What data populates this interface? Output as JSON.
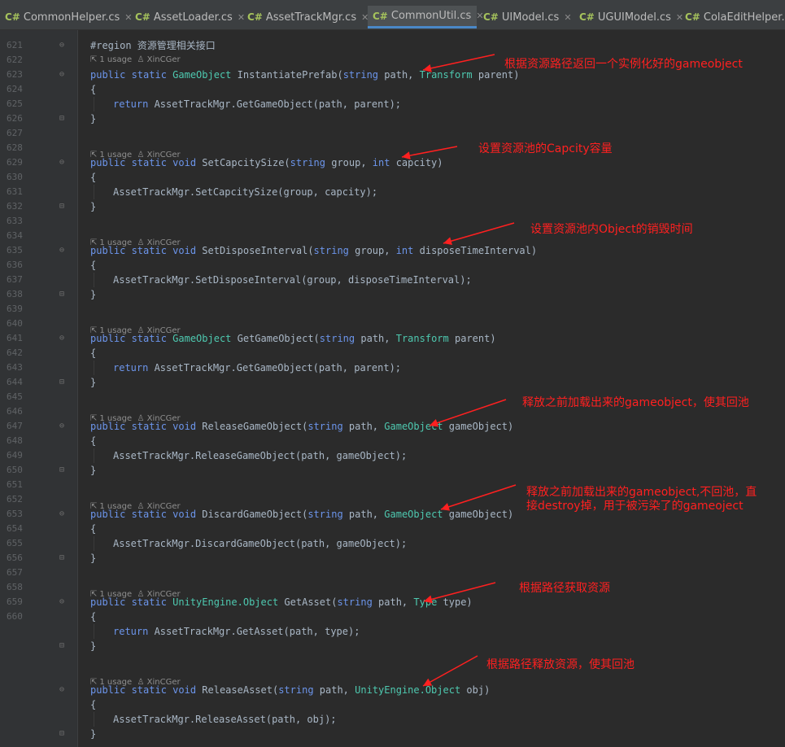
{
  "tabs": [
    {
      "label": "CommonHelper.cs",
      "icon": "C#",
      "active": false
    },
    {
      "label": "AssetLoader.cs",
      "icon": "C#",
      "active": false
    },
    {
      "label": "AssetTrackMgr.cs",
      "icon": "C#",
      "active": false
    },
    {
      "label": "CommonUtil.cs",
      "icon": "C#",
      "active": true
    },
    {
      "label": "UIModel.cs",
      "icon": "C#",
      "active": false
    },
    {
      "label": "UGUIModel.cs",
      "icon": "C#",
      "active": false
    },
    {
      "label": "ColaEditHelper.cs",
      "icon": "C#",
      "active": false
    }
  ],
  "code_lens": {
    "usage": "1 usage",
    "author": "XinCGer"
  },
  "line_numbers": [
    "621",
    "622",
    "623",
    "624",
    "625",
    "626",
    "627",
    "628",
    "629",
    "630",
    "631",
    "632",
    "633",
    "634",
    "635",
    "636",
    "637",
    "638",
    "639",
    "640",
    "641",
    "642",
    "643",
    "644",
    "645",
    "646",
    "647",
    "648",
    "649",
    "650",
    "651",
    "652",
    "653",
    "654",
    "655",
    "656",
    "657",
    "658",
    "659",
    "660"
  ],
  "code": {
    "region": "#region 资源管理相关接口",
    "methods": [
      {
        "sig_kw": "public static ",
        "ret": "GameObject",
        "name": " InstantiatePrefab(",
        "p1kw": "string",
        "p1": " path, ",
        "p2ty": "Transform",
        "p2": " parent)",
        "body": "return AssetTrackMgr.GetGameObject(path, parent);"
      },
      {
        "sig_kw": "public static void",
        "ret": "",
        "name": " SetCapcitySize(",
        "p1kw": "string",
        "p1": " group, ",
        "p2ty": "int",
        "p2": " capcity)",
        "body": "AssetTrackMgr.SetCapcitySize(group, capcity);"
      },
      {
        "sig_kw": "public static void",
        "ret": "",
        "name": " SetDisposeInterval(",
        "p1kw": "string",
        "p1": " group, ",
        "p2ty": "int",
        "p2": " disposeTimeInterval)",
        "body": "AssetTrackMgr.SetDisposeInterval(group, disposeTimeInterval);"
      },
      {
        "sig_kw": "public static ",
        "ret": "GameObject",
        "name": " GetGameObject(",
        "p1kw": "string",
        "p1": " path, ",
        "p2ty": "Transform",
        "p2": " parent)",
        "body": "return AssetTrackMgr.GetGameObject(path, parent);"
      },
      {
        "sig_kw": "public static void",
        "ret": "",
        "name": " ReleaseGameObject(",
        "p1kw": "string",
        "p1": " path, ",
        "p2ty": "GameObject",
        "p2": " gameObject)",
        "body": "AssetTrackMgr.ReleaseGameObject(path, gameObject);"
      },
      {
        "sig_kw": "public static void",
        "ret": "",
        "name": " DiscardGameObject(",
        "p1kw": "string",
        "p1": " path, ",
        "p2ty": "GameObject",
        "p2": " gameObject)",
        "body": "AssetTrackMgr.DiscardGameObject(path, gameObject);"
      },
      {
        "sig_kw": "public static ",
        "ret": "UnityEngine.Object",
        "name": " GetAsset(",
        "p1kw": "string",
        "p1": " path, ",
        "p2ty": "Type",
        "p2": " type)",
        "body": "return AssetTrackMgr.GetAsset(path, type);"
      },
      {
        "sig_kw": "public static void",
        "ret": "",
        "name": " ReleaseAsset(",
        "p1kw": "string",
        "p1": " path, ",
        "p2ty": "UnityEngine.Object",
        "p2": " obj)",
        "body": "AssetTrackMgr.ReleaseAsset(path, obj);"
      }
    ],
    "open_brace": "{",
    "close_brace": "}"
  },
  "annotations": [
    "根据资源路径返回一个实例化好的gameobject",
    "设置资源池的Capcity容量",
    "设置资源池内Object的销毁时间",
    "释放之前加载出来的gameobject，使其回池",
    "释放之前加载出来的gameobject,不回池，直",
    "接destroy掉，用于被污染了的gameoject",
    "根据路径获取资源",
    "根据路径释放资源，使其回池"
  ],
  "colors": {
    "keyword": "#6c95eb",
    "type": "#4ec9b0",
    "text": "#a9b7c6",
    "annotation": "#ff2020",
    "background": "#2b2b2b"
  }
}
